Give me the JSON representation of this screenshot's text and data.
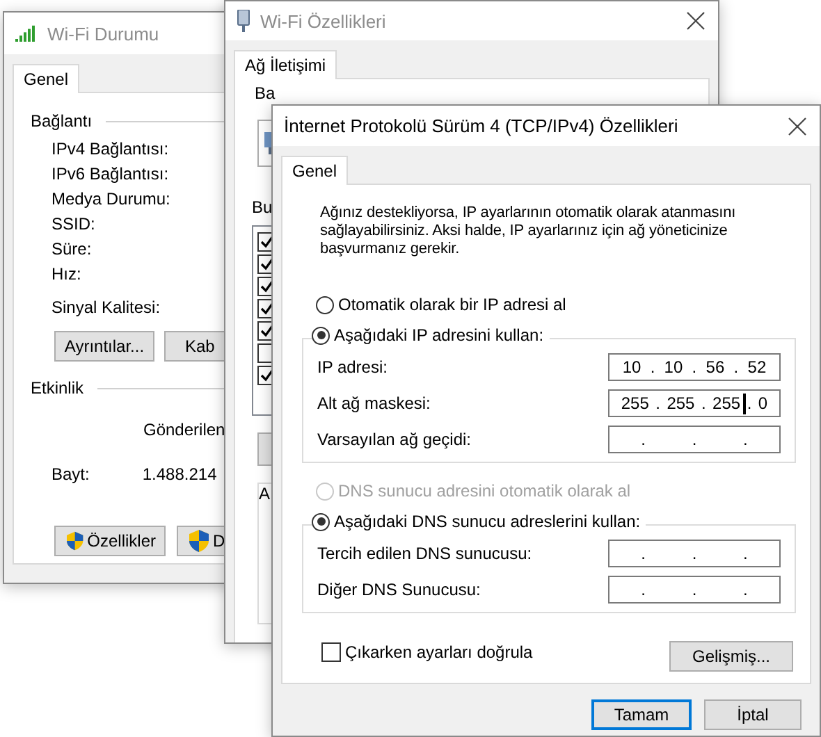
{
  "status_window": {
    "title": "Wi-Fi Durumu",
    "tab": {
      "label": "Genel",
      "selected": true
    },
    "connection": {
      "heading": "Bağlantı",
      "labels": [
        "IPv4 Bağlantısı:",
        "IPv6 Bağlantısı:",
        "Medya Durumu:",
        "SSID:",
        "Süre:",
        "Hız:"
      ],
      "signal_label": "Sinyal Kalitesi:"
    },
    "buttons": [
      "Ayrıntılar...",
      "Kab"
    ],
    "activity": {
      "heading": "Etkinlik",
      "sent_header": "Gönderilen",
      "row_label": "Bayt:",
      "row_sent": "1.488.214"
    },
    "bottom_buttons": [
      {
        "label": "Özellikler"
      },
      {
        "label": "D"
      }
    ]
  },
  "properties_window": {
    "title": "Wi-Fi Özellikleri",
    "tab": {
      "label": "Ağ İletişimi",
      "selected": true
    },
    "connect_label": "Ba",
    "items_label": "Bu",
    "items": [
      {
        "checked": true
      },
      {
        "checked": true
      },
      {
        "checked": true
      },
      {
        "checked": true
      },
      {
        "checked": true
      },
      {
        "checked": false
      },
      {
        "checked": true
      }
    ],
    "group_label": "A"
  },
  "ipv4_dialog": {
    "title": "İnternet Protokolü Sürüm 4 (TCP/IPv4) Özellikleri",
    "tab": {
      "label": "Genel",
      "selected": true
    },
    "description": "Ağınız destekliyorsa, IP ayarlarının otomatik olarak atanmasını sağlayabilirsiniz. Aksi halde, IP ayarlarınız için ağ yöneticinize başvurmanız gerekir.",
    "ip_groups": [
      {
        "auto_option": {
          "label": "Otomatik olarak bir IP adresi al",
          "selected": false,
          "disabled": false
        },
        "manual_option": {
          "label": "Aşağıdaki IP adresini kullan:",
          "selected": true
        },
        "fields": [
          {
            "label": "IP adresi:",
            "parts": [
              "10",
              ".",
              "10",
              ".",
              "56",
              ".",
              "52"
            ],
            "focused": false
          },
          {
            "label": "Alt ağ maskesi:",
            "parts": [
              "255",
              ".",
              "255",
              ".",
              "255",
              ".",
              "0"
            ],
            "focused": true
          },
          {
            "label": "Varsayılan ağ geçidi:",
            "parts": [
              ".",
              ".",
              "."
            ],
            "focused": false
          }
        ]
      },
      {
        "auto_option": {
          "label": "DNS sunucu adresini otomatik olarak al",
          "selected": false,
          "disabled": true
        },
        "manual_option": {
          "label": "Aşağıdaki DNS sunucu adreslerini kullan:",
          "selected": true
        },
        "fields": [
          {
            "label": "Tercih edilen DNS sunucusu:",
            "parts": [
              ".",
              ".",
              "."
            ],
            "focused": false
          },
          {
            "label": "Diğer DNS Sunucusu:",
            "parts": [
              ".",
              ".",
              "."
            ],
            "focused": false
          }
        ]
      }
    ],
    "validate": {
      "label": "Çıkarken ayarları doğrula",
      "checked": false
    },
    "advanced_button": "Gelişmiş...",
    "ok_button": "Tamam",
    "cancel_button": "İptal"
  }
}
